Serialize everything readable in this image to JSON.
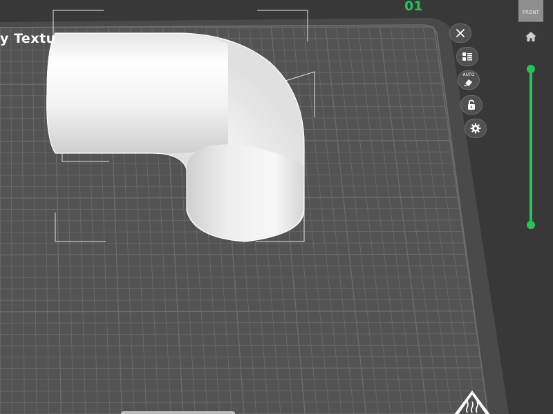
{
  "plate": {
    "title": "y Textu",
    "plate_number": "01"
  },
  "view": {
    "cube_label": "FRONT",
    "home_icon": "home-icon"
  },
  "toolbar": {
    "close_icon": "close-icon",
    "list_icon": "object-list-icon",
    "auto_label": "AUTO",
    "auto_icon": "auto-arrange-icon",
    "lock_icon": "lock-icon",
    "settings_icon": "gear-icon"
  },
  "layer_slider": {
    "range": [
      0,
      1
    ],
    "color": "#25c45b"
  },
  "warning": {
    "icon": "hot-surface-warning-icon"
  },
  "colors": {
    "background": "#383838",
    "plate": "#515151",
    "grid": "#6a6a6a",
    "model": "#f2f2f2",
    "accent": "#25c45b"
  }
}
